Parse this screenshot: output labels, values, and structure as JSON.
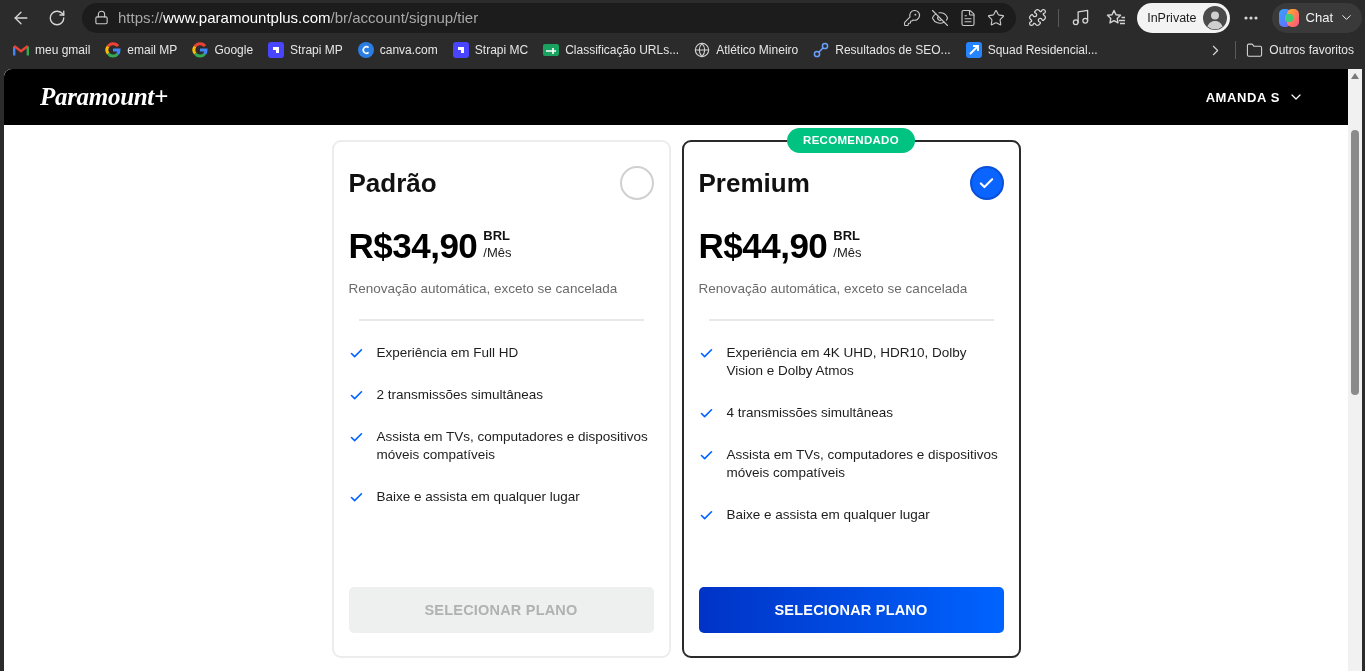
{
  "browser": {
    "url": {
      "scheme": "https://",
      "host": "www.paramountplus.com",
      "path": "/br/account/signup/tier"
    },
    "profile": "InPrivate",
    "chat": "Chat"
  },
  "bookmarks_bar": {
    "items": [
      {
        "label": "meu gmail",
        "kind": "mail"
      },
      {
        "label": "email MP",
        "kind": "g"
      },
      {
        "label": "Google",
        "kind": "g"
      },
      {
        "label": "Strapi MP",
        "kind": "tile"
      },
      {
        "label": "canva.com",
        "kind": "disc"
      },
      {
        "label": "Strapi MC",
        "kind": "tile"
      },
      {
        "label": "Classificação URLs...",
        "kind": "sheet"
      },
      {
        "label": "Atlético Mineiro",
        "kind": "globe"
      },
      {
        "label": "Resultados de SEO...",
        "kind": "nodes"
      },
      {
        "label": "Squad Residencial...",
        "kind": "arrows"
      }
    ],
    "other_favorites": "Outros favoritos"
  },
  "header": {
    "logo": "Paramount+",
    "user": "AMANDA S"
  },
  "plans": [
    {
      "name": "Padrão",
      "selected": false,
      "price": "R$34,90",
      "currency": "BRL",
      "period": "/Mês",
      "renewal": "Renovação automática, exceto se cancelada",
      "features": [
        "Experiência em Full HD",
        "2 transmissões simultâneas",
        "Assista em TVs, computadores e dispositivos móveis compatíveis",
        "Baixe e assista em qualquer lugar"
      ],
      "button": "SELECIONAR PLANO"
    },
    {
      "name": "Premium",
      "badge": "RECOMENDADO",
      "selected": true,
      "price": "R$44,90",
      "currency": "BRL",
      "period": "/Mês",
      "renewal": "Renovação automática, exceto se cancelada",
      "features": [
        "Experiência em 4K UHD, HDR10, Dolby Vision e Dolby Atmos",
        "4 transmissões simultâneas",
        "Assista em TVs, computadores e dispositivos móveis compatíveis",
        "Baixe e assista em qualquer lugar"
      ],
      "button": "SELECIONAR PLANO"
    }
  ]
}
